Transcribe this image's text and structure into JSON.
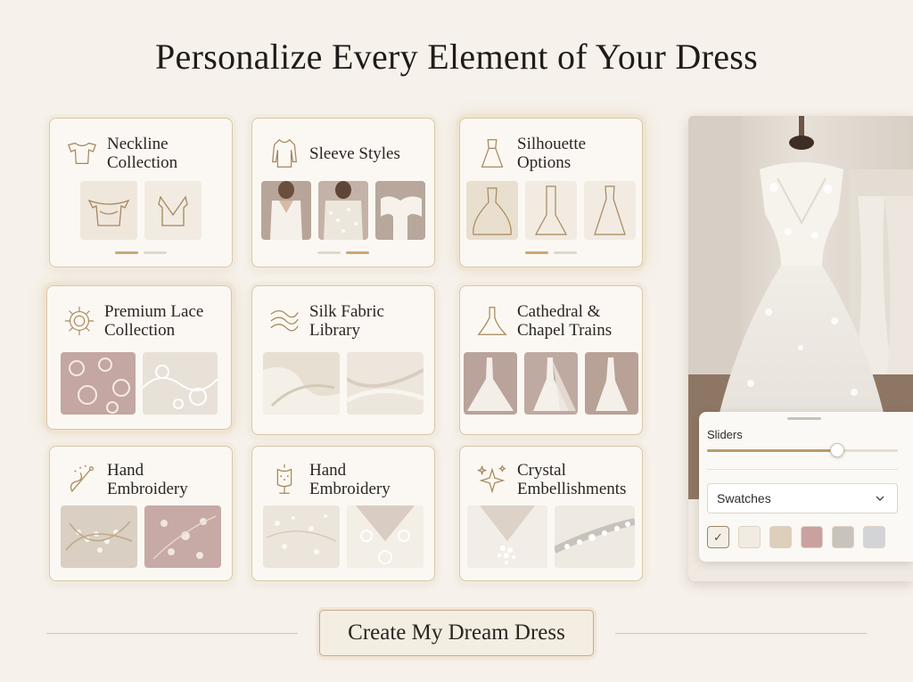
{
  "page": {
    "title": "Personalize Every Element of Your Dress"
  },
  "cards": [
    {
      "title": "Neckline Collection",
      "icon": "neckline-icon",
      "carousel_page": 1,
      "carousel_pages": 2
    },
    {
      "title": "Sleeve Styles",
      "icon": "sleeve-icon",
      "carousel_page": 2,
      "carousel_pages": 2
    },
    {
      "title": "Silhouette Options",
      "icon": "gown-icon",
      "carousel_page": 1,
      "carousel_pages": 2
    },
    {
      "title": "Premium Lace Collection",
      "icon": "lace-medallion-icon"
    },
    {
      "title": "Silk Fabric Library",
      "icon": "silk-waves-icon"
    },
    {
      "title": "Cathedral & Chapel Trains",
      "icon": "train-gown-icon"
    },
    {
      "title": "Hand Embroidery",
      "icon": "needle-thread-icon"
    },
    {
      "title": "Hand Embroidery",
      "icon": "dress-form-icon"
    },
    {
      "title": "Crystal Embellishments",
      "icon": "sparkle-icon"
    }
  ],
  "controls": {
    "sliders_label": "Sliders",
    "slider_value": 0.68,
    "swatches_select": "Swatches",
    "swatches": [
      {
        "color": "#f4efe6",
        "selected": true
      },
      {
        "color": "#f2ebe2"
      },
      {
        "color": "#ddcfb9"
      },
      {
        "color": "#c9a1a0"
      },
      {
        "color": "#c8c3bd"
      },
      {
        "color": "#d3d4d6"
      }
    ]
  },
  "cta": {
    "label": "Create My Dream Dress"
  },
  "colors": {
    "accent_gold": "#c9a877",
    "background": "#f6f1ea",
    "card": "#fbf8f3"
  }
}
